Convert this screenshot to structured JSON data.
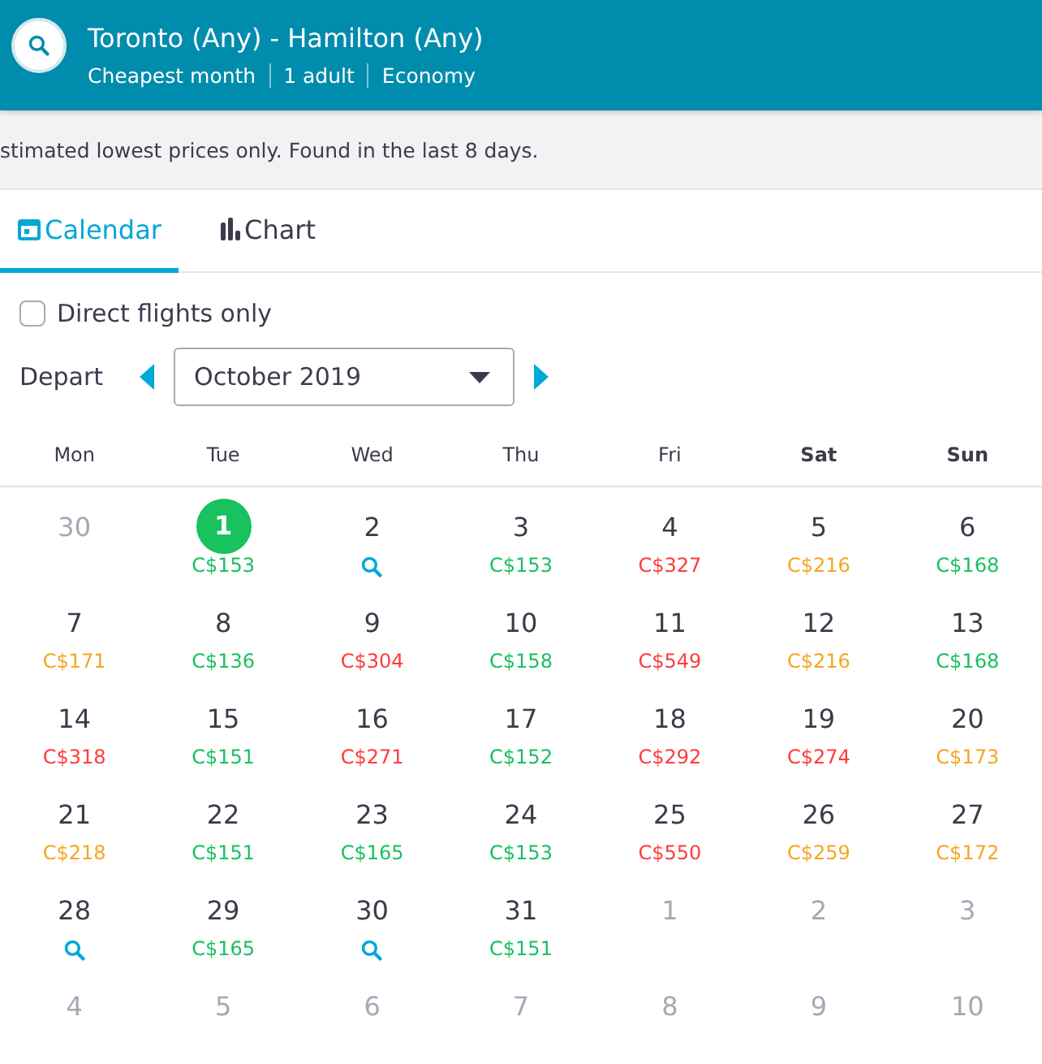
{
  "header": {
    "title": "Toronto (Any) - Hamilton (Any)",
    "details": [
      "Cheapest month",
      "1 adult",
      "Economy"
    ]
  },
  "notice": "stimated lowest prices only. Found in the last 8 days.",
  "tabs": [
    {
      "label": "Calendar",
      "selected": true
    },
    {
      "label": "Chart",
      "selected": false
    }
  ],
  "direct_flights": {
    "label": "Direct flights only",
    "checked": false
  },
  "depart": {
    "label": "Depart",
    "month": "October 2019"
  },
  "weekdays": [
    {
      "label": "Mon",
      "weekend": false
    },
    {
      "label": "Tue",
      "weekend": false
    },
    {
      "label": "Wed",
      "weekend": false
    },
    {
      "label": "Thu",
      "weekend": false
    },
    {
      "label": "Fri",
      "weekend": false
    },
    {
      "label": "Sat",
      "weekend": true
    },
    {
      "label": "Sun",
      "weekend": true
    }
  ],
  "weeks": [
    [
      {
        "day": "30",
        "kind": "outside"
      },
      {
        "day": "1",
        "kind": "price",
        "price": "C$153",
        "color": "#19c15f",
        "selected": true
      },
      {
        "day": "2",
        "kind": "search",
        "selected": false
      },
      {
        "day": "3",
        "kind": "price",
        "price": "C$153",
        "color": "#19c15f",
        "selected": false
      },
      {
        "day": "4",
        "kind": "price",
        "price": "C$327",
        "color": "#ff3b3b",
        "selected": false
      },
      {
        "day": "5",
        "kind": "price",
        "price": "C$216",
        "color": "#f5a623",
        "selected": false
      },
      {
        "day": "6",
        "kind": "price",
        "price": "C$168",
        "color": "#19c15f",
        "selected": false
      }
    ],
    [
      {
        "day": "7",
        "kind": "price",
        "price": "C$171",
        "color": "#f5a623",
        "selected": false
      },
      {
        "day": "8",
        "kind": "price",
        "price": "C$136",
        "color": "#19c15f",
        "selected": false
      },
      {
        "day": "9",
        "kind": "price",
        "price": "C$304",
        "color": "#ff3b3b",
        "selected": false
      },
      {
        "day": "10",
        "kind": "price",
        "price": "C$158",
        "color": "#19c15f",
        "selected": false
      },
      {
        "day": "11",
        "kind": "price",
        "price": "C$549",
        "color": "#ff3b3b",
        "selected": false
      },
      {
        "day": "12",
        "kind": "price",
        "price": "C$216",
        "color": "#f5a623",
        "selected": false
      },
      {
        "day": "13",
        "kind": "price",
        "price": "C$168",
        "color": "#19c15f",
        "selected": false
      }
    ],
    [
      {
        "day": "14",
        "kind": "price",
        "price": "C$318",
        "color": "#ff3b3b",
        "selected": false
      },
      {
        "day": "15",
        "kind": "price",
        "price": "C$151",
        "color": "#19c15f",
        "selected": false
      },
      {
        "day": "16",
        "kind": "price",
        "price": "C$271",
        "color": "#ff3b3b",
        "selected": false
      },
      {
        "day": "17",
        "kind": "price",
        "price": "C$152",
        "color": "#19c15f",
        "selected": false
      },
      {
        "day": "18",
        "kind": "price",
        "price": "C$292",
        "color": "#ff3b3b",
        "selected": false
      },
      {
        "day": "19",
        "kind": "price",
        "price": "C$274",
        "color": "#ff3b3b",
        "selected": false
      },
      {
        "day": "20",
        "kind": "price",
        "price": "C$173",
        "color": "#f5a623",
        "selected": false
      }
    ],
    [
      {
        "day": "21",
        "kind": "price",
        "price": "C$218",
        "color": "#f5a623",
        "selected": false
      },
      {
        "day": "22",
        "kind": "price",
        "price": "C$151",
        "color": "#19c15f",
        "selected": false
      },
      {
        "day": "23",
        "kind": "price",
        "price": "C$165",
        "color": "#19c15f",
        "selected": false
      },
      {
        "day": "24",
        "kind": "price",
        "price": "C$153",
        "color": "#19c15f",
        "selected": false
      },
      {
        "day": "25",
        "kind": "price",
        "price": "C$550",
        "color": "#ff3b3b",
        "selected": false
      },
      {
        "day": "26",
        "kind": "price",
        "price": "C$259",
        "color": "#f5a623",
        "selected": false
      },
      {
        "day": "27",
        "kind": "price",
        "price": "C$172",
        "color": "#f5a623",
        "selected": false
      }
    ],
    [
      {
        "day": "28",
        "kind": "search",
        "selected": false
      },
      {
        "day": "29",
        "kind": "price",
        "price": "C$165",
        "color": "#19c15f",
        "selected": false
      },
      {
        "day": "30",
        "kind": "search",
        "selected": false
      },
      {
        "day": "31",
        "kind": "price",
        "price": "C$151",
        "color": "#19c15f",
        "selected": false
      },
      {
        "day": "1",
        "kind": "outside"
      },
      {
        "day": "2",
        "kind": "outside"
      },
      {
        "day": "3",
        "kind": "outside"
      }
    ],
    [
      {
        "day": "4",
        "kind": "outside"
      },
      {
        "day": "5",
        "kind": "outside"
      },
      {
        "day": "6",
        "kind": "outside"
      },
      {
        "day": "7",
        "kind": "outside"
      },
      {
        "day": "8",
        "kind": "outside"
      },
      {
        "day": "9",
        "kind": "outside"
      },
      {
        "day": "10",
        "kind": "outside"
      }
    ]
  ]
}
